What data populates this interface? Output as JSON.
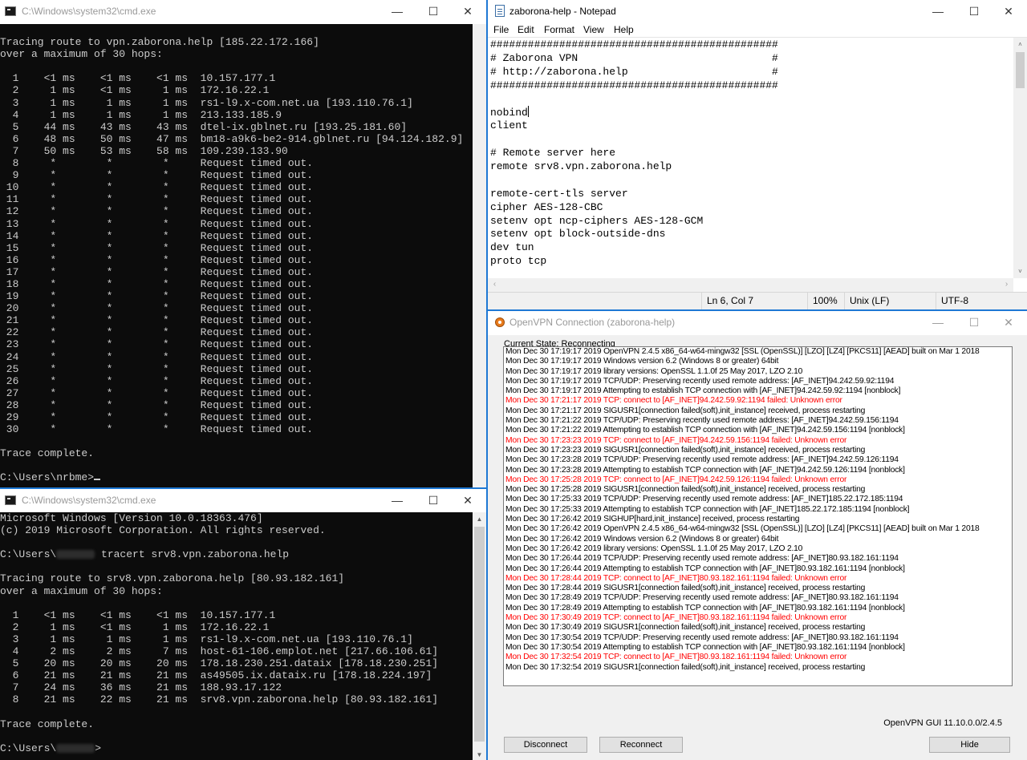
{
  "cmd_top": {
    "title": "C:\\Windows\\system32\\cmd.exe",
    "controls": {
      "minimize": "—",
      "maximize": "☐",
      "close": "✕"
    },
    "lines": [
      "",
      "Tracing route to vpn.zaborona.help [185.22.172.166]",
      "over a maximum of 30 hops:",
      "",
      "  1    <1 ms    <1 ms    <1 ms  10.157.177.1",
      "  2     1 ms    <1 ms     1 ms  172.16.22.1",
      "  3     1 ms     1 ms     1 ms  rs1-l9.x-com.net.ua [193.110.76.1]",
      "  4     1 ms     1 ms     1 ms  213.133.185.9",
      "  5    44 ms    43 ms    43 ms  dtel-ix.gblnet.ru [193.25.181.60]",
      "  6    48 ms    50 ms    47 ms  bm18-a9k6-be2-914.gblnet.ru [94.124.182.9]",
      "  7    50 ms    53 ms    58 ms  109.239.133.90",
      "  8     *        *        *     Request timed out.",
      "  9     *        *        *     Request timed out.",
      " 10     *        *        *     Request timed out.",
      " 11     *        *        *     Request timed out.",
      " 12     *        *        *     Request timed out.",
      " 13     *        *        *     Request timed out.",
      " 14     *        *        *     Request timed out.",
      " 15     *        *        *     Request timed out.",
      " 16     *        *        *     Request timed out.",
      " 17     *        *        *     Request timed out.",
      " 18     *        *        *     Request timed out.",
      " 19     *        *        *     Request timed out.",
      " 20     *        *        *     Request timed out.",
      " 21     *        *        *     Request timed out.",
      " 22     *        *        *     Request timed out.",
      " 23     *        *        *     Request timed out.",
      " 24     *        *        *     Request timed out.",
      " 25     *        *        *     Request timed out.",
      " 26     *        *        *     Request timed out.",
      " 27     *        *        *     Request timed out.",
      " 28     *        *        *     Request timed out.",
      " 29     *        *        *     Request timed out.",
      " 30     *        *        *     Request timed out.",
      "",
      "Trace complete.",
      ""
    ],
    "prompt": "C:\\Users\\nrbme>"
  },
  "cmd_bottom": {
    "title": "C:\\Windows\\system32\\cmd.exe",
    "controls": {
      "minimize": "—",
      "maximize": "☐",
      "close": "✕"
    },
    "line_version": "Microsoft Windows [Version 10.0.18363.476]",
    "line_copyright": "(c) 2019 Microsoft Corporation. All rights reserved.",
    "cmd_prefix": "C:\\Users\\",
    "cmd_text": " tracert srv8.vpn.zaborona.help",
    "lines": [
      "",
      "Tracing route to srv8.vpn.zaborona.help [80.93.182.161]",
      "over a maximum of 30 hops:",
      "",
      "  1    <1 ms    <1 ms    <1 ms  10.157.177.1",
      "  2     1 ms    <1 ms     1 ms  172.16.22.1",
      "  3     1 ms     1 ms     1 ms  rs1-l9.x-com.net.ua [193.110.76.1]",
      "  4     2 ms     2 ms     7 ms  host-61-106.emplot.net [217.66.106.61]",
      "  5    20 ms    20 ms    20 ms  178.18.230.251.dataix [178.18.230.251]",
      "  6    21 ms    21 ms    21 ms  as49505.ix.dataix.ru [178.18.224.197]",
      "  7    24 ms    36 ms    21 ms  188.93.17.122",
      "  8    21 ms    22 ms    21 ms  srv8.vpn.zaborona.help [80.93.182.161]",
      "",
      "Trace complete.",
      ""
    ],
    "prompt_prefix": "C:\\Users\\",
    "prompt_suffix": ">"
  },
  "notepad": {
    "title": "zaborona-help - Notepad",
    "controls": {
      "minimize": "—",
      "maximize": "☐",
      "close": "✕"
    },
    "menu": [
      "File",
      "Edit",
      "Format",
      "View",
      "Help"
    ],
    "lines": [
      "##############################################",
      "# Zaborona VPN                               #",
      "# http://zaborona.help                       #",
      "##############################################",
      "",
      "nobind",
      "client",
      "",
      "# Remote server here",
      "remote srv8.vpn.zaborona.help",
      "",
      "remote-cert-tls server",
      "cipher AES-128-CBC",
      "setenv opt ncp-ciphers AES-128-GCM",
      "setenv opt block-outside-dns",
      "dev tun",
      "proto tcp"
    ],
    "status": {
      "position": "Ln 6, Col 7",
      "zoom": "100%",
      "line_ending": "Unix (LF)",
      "encoding": "UTF-8"
    }
  },
  "openvpn": {
    "title": "OpenVPN Connection (zaborona-help)",
    "controls": {
      "minimize": "—",
      "maximize": "☐",
      "close": "✕"
    },
    "state_label": "Current State: Reconnecting",
    "log": [
      {
        "t": "Mon Dec 30 17:19:17 2019 OpenVPN 2.4.5 x86_64-w64-mingw32 [SSL (OpenSSL)] [LZO] [LZ4] [PKCS11] [AEAD] built on Mar  1 2018",
        "e": false
      },
      {
        "t": "Mon Dec 30 17:19:17 2019 Windows version 6.2 (Windows 8 or greater) 64bit",
        "e": false
      },
      {
        "t": "Mon Dec 30 17:19:17 2019 library versions: OpenSSL 1.1.0f  25 May 2017, LZO 2.10",
        "e": false
      },
      {
        "t": "Mon Dec 30 17:19:17 2019 TCP/UDP: Preserving recently used remote address: [AF_INET]94.242.59.92:1194",
        "e": false
      },
      {
        "t": "Mon Dec 30 17:19:17 2019 Attempting to establish TCP connection with [AF_INET]94.242.59.92:1194 [nonblock]",
        "e": false
      },
      {
        "t": "Mon Dec 30 17:21:17 2019 TCP: connect to [AF_INET]94.242.59.92:1194 failed: Unknown error",
        "e": true
      },
      {
        "t": "Mon Dec 30 17:21:17 2019 SIGUSR1[connection failed(soft),init_instance] received, process restarting",
        "e": false
      },
      {
        "t": "Mon Dec 30 17:21:22 2019 TCP/UDP: Preserving recently used remote address: [AF_INET]94.242.59.156:1194",
        "e": false
      },
      {
        "t": "Mon Dec 30 17:21:22 2019 Attempting to establish TCP connection with [AF_INET]94.242.59.156:1194 [nonblock]",
        "e": false
      },
      {
        "t": "Mon Dec 30 17:23:23 2019 TCP: connect to [AF_INET]94.242.59.156:1194 failed: Unknown error",
        "e": true
      },
      {
        "t": "Mon Dec 30 17:23:23 2019 SIGUSR1[connection failed(soft),init_instance] received, process restarting",
        "e": false
      },
      {
        "t": "Mon Dec 30 17:23:28 2019 TCP/UDP: Preserving recently used remote address: [AF_INET]94.242.59.126:1194",
        "e": false
      },
      {
        "t": "Mon Dec 30 17:23:28 2019 Attempting to establish TCP connection with [AF_INET]94.242.59.126:1194 [nonblock]",
        "e": false
      },
      {
        "t": "Mon Dec 30 17:25:28 2019 TCP: connect to [AF_INET]94.242.59.126:1194 failed: Unknown error",
        "e": true
      },
      {
        "t": "Mon Dec 30 17:25:28 2019 SIGUSR1[connection failed(soft),init_instance] received, process restarting",
        "e": false
      },
      {
        "t": "Mon Dec 30 17:25:33 2019 TCP/UDP: Preserving recently used remote address: [AF_INET]185.22.172.185:1194",
        "e": false
      },
      {
        "t": "Mon Dec 30 17:25:33 2019 Attempting to establish TCP connection with [AF_INET]185.22.172.185:1194 [nonblock]",
        "e": false
      },
      {
        "t": "Mon Dec 30 17:26:42 2019 SIGHUP[hard,init_instance] received, process restarting",
        "e": false
      },
      {
        "t": "Mon Dec 30 17:26:42 2019 OpenVPN 2.4.5 x86_64-w64-mingw32 [SSL (OpenSSL)] [LZO] [LZ4] [PKCS11] [AEAD] built on Mar  1 2018",
        "e": false
      },
      {
        "t": "Mon Dec 30 17:26:42 2019 Windows version 6.2 (Windows 8 or greater) 64bit",
        "e": false
      },
      {
        "t": "Mon Dec 30 17:26:42 2019 library versions: OpenSSL 1.1.0f  25 May 2017, LZO 2.10",
        "e": false
      },
      {
        "t": "Mon Dec 30 17:26:44 2019 TCP/UDP: Preserving recently used remote address: [AF_INET]80.93.182.161:1194",
        "e": false
      },
      {
        "t": "Mon Dec 30 17:26:44 2019 Attempting to establish TCP connection with [AF_INET]80.93.182.161:1194 [nonblock]",
        "e": false
      },
      {
        "t": "Mon Dec 30 17:28:44 2019 TCP: connect to [AF_INET]80.93.182.161:1194 failed: Unknown error",
        "e": true
      },
      {
        "t": "Mon Dec 30 17:28:44 2019 SIGUSR1[connection failed(soft),init_instance] received, process restarting",
        "e": false
      },
      {
        "t": "Mon Dec 30 17:28:49 2019 TCP/UDP: Preserving recently used remote address: [AF_INET]80.93.182.161:1194",
        "e": false
      },
      {
        "t": "Mon Dec 30 17:28:49 2019 Attempting to establish TCP connection with [AF_INET]80.93.182.161:1194 [nonblock]",
        "e": false
      },
      {
        "t": "Mon Dec 30 17:30:49 2019 TCP: connect to [AF_INET]80.93.182.161:1194 failed: Unknown error",
        "e": true
      },
      {
        "t": "Mon Dec 30 17:30:49 2019 SIGUSR1[connection failed(soft),init_instance] received, process restarting",
        "e": false
      },
      {
        "t": "Mon Dec 30 17:30:54 2019 TCP/UDP: Preserving recently used remote address: [AF_INET]80.93.182.161:1194",
        "e": false
      },
      {
        "t": "Mon Dec 30 17:30:54 2019 Attempting to establish TCP connection with [AF_INET]80.93.182.161:1194 [nonblock]",
        "e": false
      },
      {
        "t": "Mon Dec 30 17:32:54 2019 TCP: connect to [AF_INET]80.93.182.161:1194 failed: Unknown error",
        "e": true
      },
      {
        "t": "Mon Dec 30 17:32:54 2019 SIGUSR1[connection failed(soft),init_instance] received, process restarting",
        "e": false
      }
    ],
    "version": "OpenVPN GUI 11.10.0.0/2.4.5",
    "buttons": {
      "disconnect": "Disconnect",
      "reconnect": "Reconnect",
      "hide": "Hide"
    }
  },
  "colors": {
    "console_bg": "#0c0c0c",
    "console_fg": "#cccccc",
    "error_red": "#ff0000",
    "accent_blue": "#1e78d4"
  },
  "icons": [
    "cmd-icon",
    "notepad-icon",
    "openvpn-icon"
  ]
}
